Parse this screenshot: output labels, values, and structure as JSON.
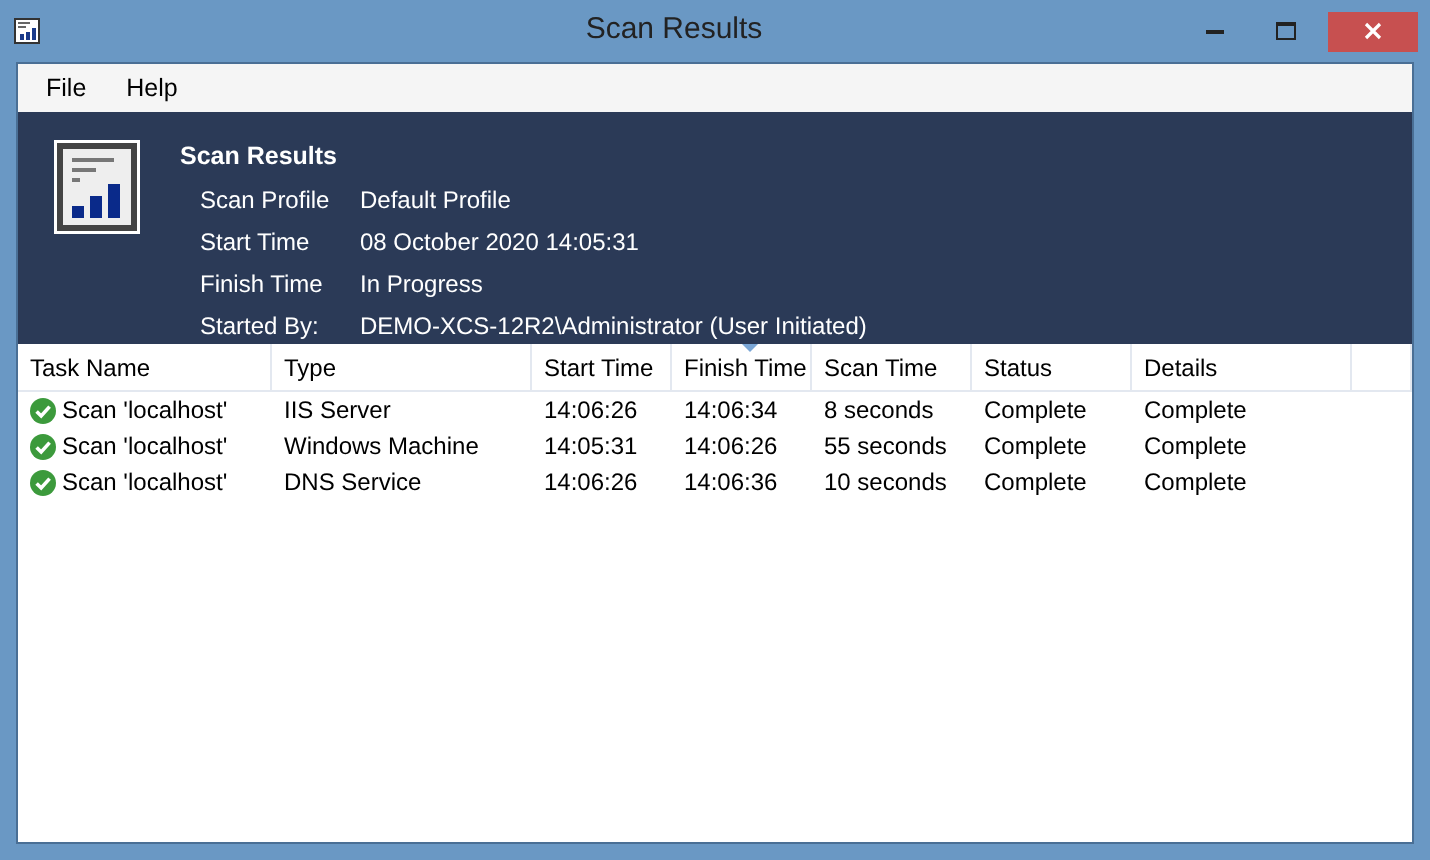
{
  "window": {
    "title": "Scan Results"
  },
  "menu": [
    "File",
    "Help"
  ],
  "header": {
    "title": "Scan Results",
    "fields": [
      {
        "label": "Scan Profile",
        "value": "Default Profile"
      },
      {
        "label": "Start Time",
        "value": "08 October 2020 14:05:31"
      },
      {
        "label": "Finish Time",
        "value": "In Progress"
      },
      {
        "label": "Started By:",
        "value": "DEMO-XCS-12R2\\Administrator (User Initiated)"
      }
    ]
  },
  "table": {
    "columns": [
      {
        "label": "Task Name",
        "sorted": false
      },
      {
        "label": "Type",
        "sorted": false
      },
      {
        "label": "Start Time",
        "sorted": false
      },
      {
        "label": "Finish Time",
        "sorted": true
      },
      {
        "label": "Scan Time",
        "sorted": false
      },
      {
        "label": "Status",
        "sorted": false
      },
      {
        "label": "Details",
        "sorted": false
      }
    ],
    "rows": [
      {
        "cells": [
          "Scan 'localhost'",
          "IIS Server",
          "14:06:26",
          "14:06:34",
          "8 seconds",
          "Complete",
          "Complete"
        ]
      },
      {
        "cells": [
          "Scan 'localhost'",
          "Windows Machine",
          "14:05:31",
          "14:06:26",
          "55 seconds",
          "Complete",
          "Complete"
        ]
      },
      {
        "cells": [
          "Scan 'localhost'",
          "DNS Service",
          "14:06:26",
          "14:06:36",
          "10 seconds",
          "Complete",
          "Complete"
        ]
      }
    ]
  }
}
